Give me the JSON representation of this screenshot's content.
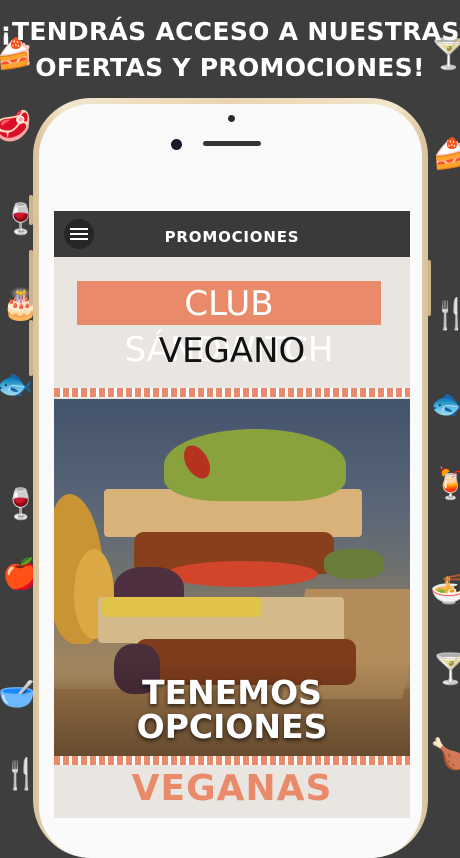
{
  "headline": {
    "line1": "¡TENDRÁS ACCESO A NUESTRAS",
    "line2": "OFERTAS Y PROMOCIONES!"
  },
  "background_icons": [
    "cake-icon",
    "steak-icon",
    "wine-glass-icon",
    "fish-icon",
    "cocktail-icon",
    "apple-icon",
    "bowl-icon",
    "fork-knife-icon"
  ],
  "app": {
    "topbar_title": "PROMOCIONES",
    "menu_icon": "hamburger-menu-icon",
    "promo_title": "CLUB SÁNDWITCH",
    "promo_subtitle": "VEGANO",
    "photo_text_line1": "TENEMOS",
    "photo_text_line2": "OPCIONES",
    "bottom_word": "VEGANAS"
  },
  "colors": {
    "background": "#3e3e3e",
    "accent": "#e98a6a",
    "topbar": "#3a3a3a",
    "screen": "#e9e6e2",
    "phone_frame": "#e8d4b0"
  }
}
